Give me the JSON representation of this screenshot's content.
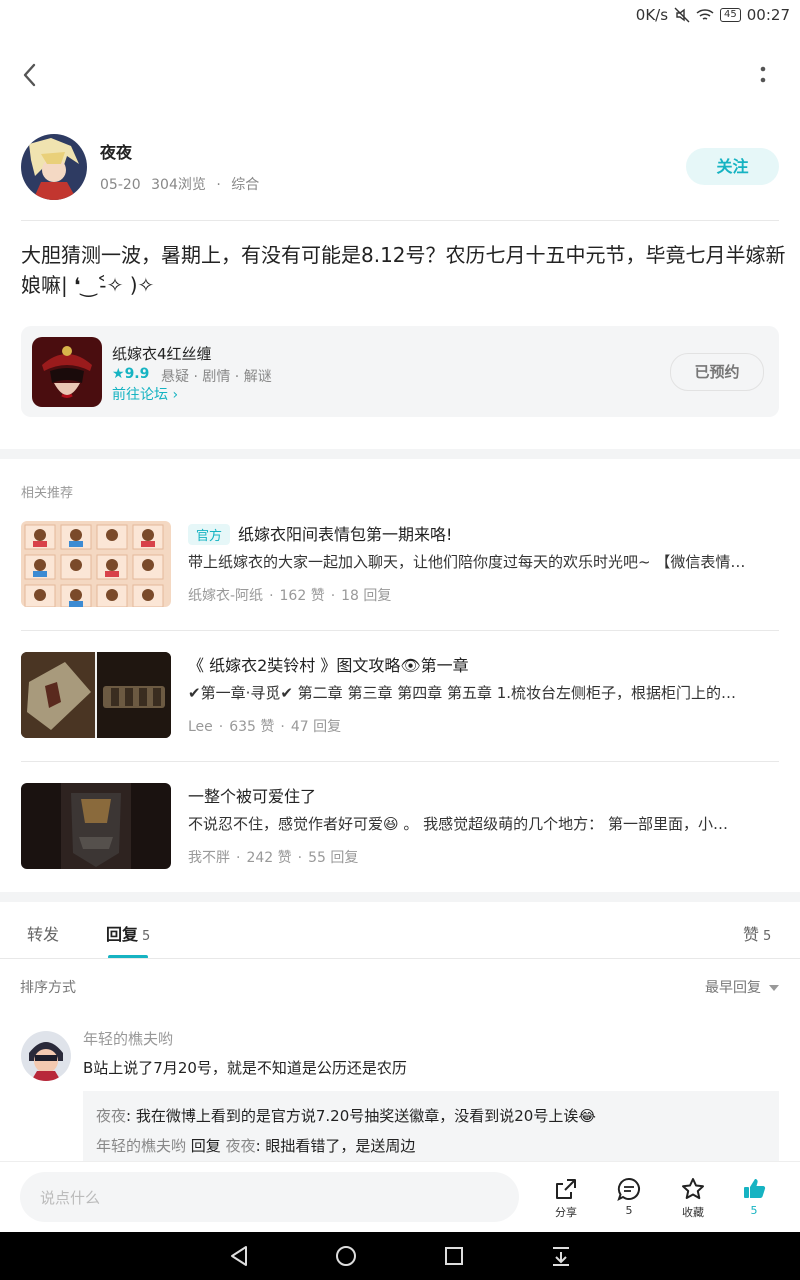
{
  "status_bar": {
    "speed": "0K/s",
    "battery": "45",
    "time": "00:27"
  },
  "author": {
    "name": "夜夜",
    "date": "05-20",
    "views": "304浏览",
    "category": "综合",
    "follow_label": "关注"
  },
  "post": {
    "text": "大胆猜测一波，暑期上，有没有可能是8.12号？农历七月十五中元节，毕竟七月半嫁新娘嘛| ❛‿˂̵✧ )✧"
  },
  "game_card": {
    "name": "纸嫁衣4红丝缠",
    "rating": "9.9",
    "tags": "悬疑 · 剧情 · 解谜",
    "forum_link": "前往论坛",
    "reserve_label": "已预约"
  },
  "related": {
    "title": "相关推荐",
    "items": [
      {
        "tag": "官方",
        "title": "纸嫁衣阳间表情包第一期来咯!",
        "desc": "带上纸嫁衣的大家一起加入聊天，让他们陪你度过每天的欢乐时光吧~ 【微信表情…",
        "author": "纸嫁衣-阿纸",
        "likes": "162 赞",
        "replies": "18 回复"
      },
      {
        "tag": "",
        "title": "《 纸嫁衣2奘铃村 》图文攻略👁第一章",
        "desc": "✔第一章·寻觅✔ 第二章 第三章 第四章 第五章 1.梳妆台左侧柜子，根据柜门上的…",
        "author": "Lee",
        "likes": "635 赞",
        "replies": "47 回复"
      },
      {
        "tag": "",
        "title": "一整个被可爱住了",
        "desc": "不说忍不住，感觉作者好可爱😆 。 我感觉超级萌的几个地方：  第一部里面，小…",
        "author": "我不胖",
        "likes": "242 赞",
        "replies": "55 回复"
      }
    ]
  },
  "tabs": {
    "forward": "转发",
    "reply": "回复",
    "reply_count": "5",
    "like": "赞",
    "like_count": "5"
  },
  "sort": {
    "label": "排序方式",
    "value": "最早回复"
  },
  "comment": {
    "user": "年轻的樵夫哟",
    "text": "B站上说了7月20号，就是不知道是公历还是农历",
    "replies": [
      {
        "user": "夜夜",
        "text": ": 我在微博上看到的是官方说7.20号抽奖送徽章，没看到说20号上诶😂"
      },
      {
        "user": "年轻的樵夫哟",
        "mid": "回复",
        "target": "夜夜",
        "text": ": 眼拙看错了，是送周边"
      }
    ]
  },
  "bottom_bar": {
    "placeholder": "说点什么",
    "share": "分享",
    "comment_count": "5",
    "favorite": "收藏",
    "like_count": "5"
  },
  "colors": {
    "accent": "#16b3c2"
  }
}
